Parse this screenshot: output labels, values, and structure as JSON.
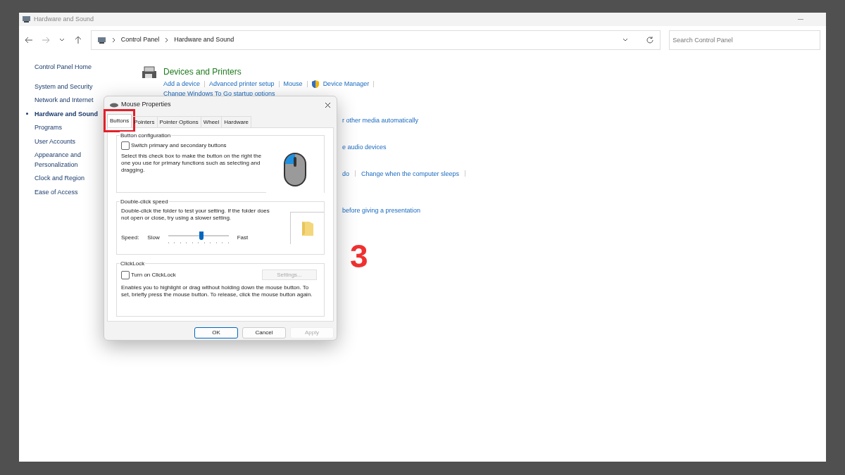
{
  "window": {
    "title": "Hardware and Sound"
  },
  "breadcrumb": [
    "Control Panel",
    "Hardware and Sound"
  ],
  "search": {
    "placeholder": "Search Control Panel"
  },
  "sidebar": {
    "home": "Control Panel Home",
    "items": [
      {
        "label": "System and Security",
        "selected": false
      },
      {
        "label": "Network and Internet",
        "selected": false
      },
      {
        "label": "Hardware and Sound",
        "selected": true
      },
      {
        "label": "Programs",
        "selected": false
      },
      {
        "label": "User Accounts",
        "selected": false
      },
      {
        "label": "Appearance and Personalization",
        "selected": false
      },
      {
        "label": "Clock and Region",
        "selected": false
      },
      {
        "label": "Ease of Access",
        "selected": false
      }
    ]
  },
  "sections": [
    {
      "title": "Devices and Printers",
      "links": [
        "Add a device",
        "Advanced printer setup",
        "Mouse",
        "Device Manager",
        "Change Windows To Go startup options"
      ]
    }
  ],
  "fragments": [
    [
      "r other media automatically"
    ],
    [
      "e audio devices"
    ],
    [
      "do",
      "Change when the computer sleeps"
    ],
    [
      "before giving a presentation"
    ]
  ],
  "dialog": {
    "title": "Mouse Properties",
    "tabs": [
      {
        "label": "Buttons",
        "selected": true,
        "highlighted": true
      },
      {
        "label": "Pointers",
        "selected": false,
        "highlighted": false
      },
      {
        "label": "Pointer Options",
        "selected": false,
        "highlighted": false
      },
      {
        "label": "Wheel",
        "selected": false,
        "highlighted": false
      },
      {
        "label": "Hardware",
        "selected": false,
        "highlighted": false
      }
    ],
    "button_configuration": {
      "title": "Button configuration",
      "checkbox": {
        "label": "Switch primary and secondary buttons",
        "checked": false
      },
      "description": "Select this check box to make the button on the right the one you use for primary functions such as selecting and dragging."
    },
    "double_click": {
      "title": "Double-click speed",
      "description": "Double-click the folder to test your setting. If the folder does not open or close, try using a slower setting.",
      "speed_label": "Speed:",
      "slow": "Slow",
      "fast": "Fast",
      "level": 0.55
    },
    "clicklock": {
      "title": "ClickLock",
      "checkbox": {
        "label": "Turn on ClickLock",
        "checked": false
      },
      "settings": {
        "label": "Settings...",
        "disabled": true
      },
      "description": "Enables you to highlight or drag without holding down the mouse button. To set, briefly press the mouse button. To release, click the mouse button again."
    },
    "buttons": [
      {
        "label": "OK",
        "kind": "default",
        "disabled": false
      },
      {
        "label": "Cancel",
        "kind": "normal",
        "disabled": false
      },
      {
        "label": "Apply",
        "kind": "normal",
        "disabled": true
      }
    ]
  },
  "annotation": {
    "step": "3"
  }
}
